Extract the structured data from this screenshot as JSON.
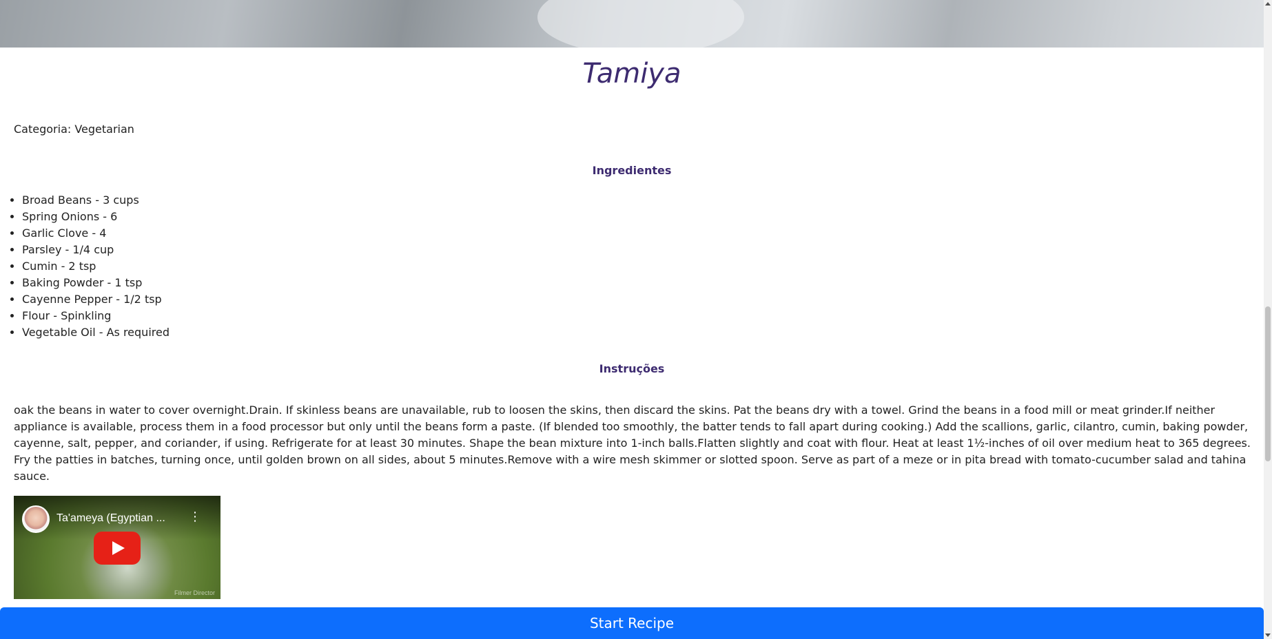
{
  "recipe": {
    "title": "Tamiya",
    "category": "Categoria: Vegetarian",
    "ingredients_heading": "Ingredientes",
    "ingredients": [
      "Broad Beans - 3 cups",
      "Spring Onions - 6",
      "Garlic Clove - 4",
      "Parsley - 1/4 cup",
      "Cumin - 2 tsp",
      "Baking Powder - 1 tsp",
      "Cayenne Pepper - 1/2 tsp",
      "Flour - Spinkling",
      "Vegetable Oil - As required"
    ],
    "instructions_heading": "Instruções",
    "instructions": "oak the beans in water to cover overnight.Drain. If skinless beans are unavailable, rub to loosen the skins, then discard the skins. Pat the beans dry with a towel. Grind the beans in a food mill or meat grinder.If neither appliance is available, process them in a food processor but only until the beans form a paste. (If blended too smoothly, the batter tends to fall apart during cooking.) Add the scallions, garlic, cilantro, cumin, baking powder, cayenne, salt, pepper, and coriander, if using. Refrigerate for at least 30 minutes. Shape the bean mixture into 1-inch balls.Flatten slightly and coat with flour. Heat at least 1½-inches of oil over medium heat to 365 degrees. Fry the patties in batches, turning once, until golden brown on all sides, about 5 minutes.Remove with a wire mesh skimmer or slotted spoon. Serve as part of a meze or in pita bread with tomato-cucumber salad and tahina sauce."
  },
  "video": {
    "title": "Ta'ameya (Egyptian ...",
    "menu_icon": "kebab-menu-icon",
    "play_icon": "youtube-play-icon",
    "watermark": "Filmer Director"
  },
  "actions": {
    "start_label": "Start Recipe"
  },
  "colors": {
    "accent": "#3d2b70",
    "button": "#0d6efd",
    "play": "#e62117"
  }
}
